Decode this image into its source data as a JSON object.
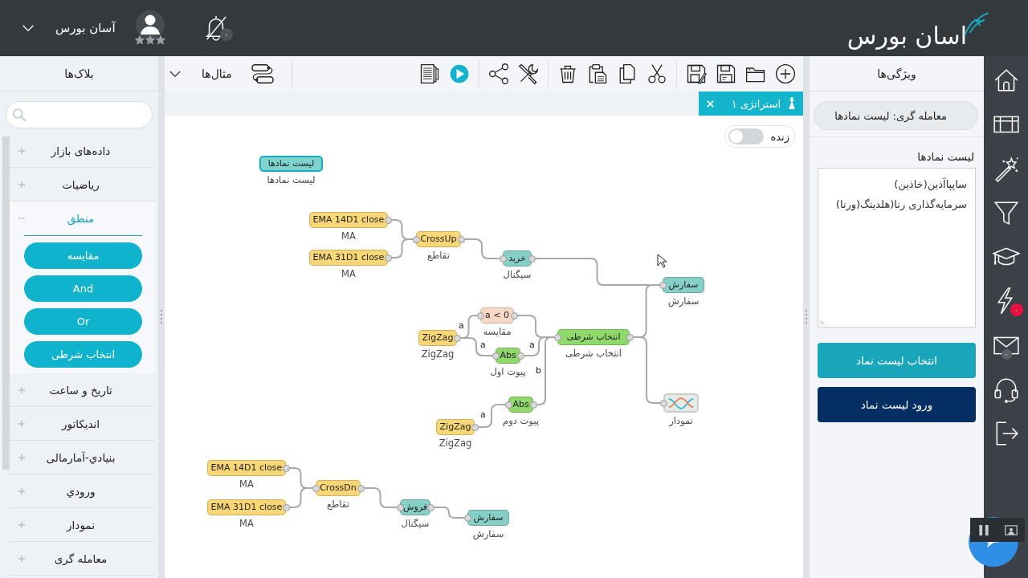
{
  "header": {
    "logo": "اسان بورس",
    "user": {
      "name": "آسان بورس",
      "stars": 3
    },
    "notification_badge": "۰"
  },
  "blocks_panel": {
    "title": "بلاک‌ها",
    "categories": [
      {
        "label": "داده‌های بازار",
        "expanded": false
      },
      {
        "label": "ریاضیات",
        "expanded": false
      },
      {
        "label": "منطق",
        "expanded": true,
        "children": [
          {
            "label": "مقایسه"
          },
          {
            "label": "And"
          },
          {
            "label": "Or"
          },
          {
            "label": "انتخاب شرطی"
          }
        ]
      },
      {
        "label": "تاریخ و ساعت",
        "expanded": false
      },
      {
        "label": "اندیکاتور",
        "expanded": false
      },
      {
        "label": "بنیادي-آمارمالی",
        "expanded": false
      },
      {
        "label": "ورودي",
        "expanded": false
      },
      {
        "label": "نمودار",
        "expanded": false
      },
      {
        "label": "معامله گری",
        "expanded": false
      }
    ]
  },
  "toolbar": {
    "examples_menu": "مثال‌ها"
  },
  "tabs": [
    {
      "label": "استراتژی ۱",
      "selected": true
    }
  ],
  "canvas": {
    "live_toggle": {
      "label": "زنده",
      "on": false
    },
    "nodes": [
      {
        "kind": "block",
        "label": "لیست نمادها",
        "caption": "لیست نمادها",
        "color": "#7fd3cf",
        "selected": true
      },
      {
        "kind": "block",
        "label": "EMA 14D1 close",
        "caption": "MA",
        "color": "#fad776",
        "selected": false
      },
      {
        "kind": "block",
        "label": "EMA 31D1 close",
        "caption": "MA",
        "color": "#fad776",
        "selected": false
      },
      {
        "kind": "block",
        "label": "CrossUp",
        "caption": "تقاطع",
        "color": "#fad776",
        "selected": false
      },
      {
        "kind": "block",
        "label": "خرید",
        "caption": "سیگنال",
        "color": "#86cfc6",
        "selected": false
      },
      {
        "kind": "block",
        "label": "سفارش",
        "caption": "سفارش",
        "color": "#86cfc6",
        "selected": false
      },
      {
        "kind": "block",
        "label": "a < 0",
        "caption": "مقایسه",
        "color": "#f8d9c6",
        "selected": false
      },
      {
        "kind": "block",
        "label": "ZigZag",
        "caption": "ZigZag",
        "color": "#fad776",
        "selected": false
      },
      {
        "kind": "block",
        "label": "Abs",
        "caption": "پیوت اول",
        "color": "#8fd96b",
        "selected": false
      },
      {
        "kind": "block",
        "label": "انتخاب شرطی",
        "caption": "انتخاب شرطی",
        "color": "#8fd96b",
        "selected": false
      },
      {
        "kind": "chart",
        "caption": "نمودار",
        "color": "#e4ebe7",
        "selected": false
      },
      {
        "kind": "block",
        "label": "Abs",
        "caption": "پیوت دوم",
        "color": "#8fd96b",
        "selected": false
      },
      {
        "kind": "block",
        "label": "ZigZag",
        "caption": "ZigZag",
        "color": "#fad776",
        "selected": false
      },
      {
        "kind": "block",
        "label": "EMA 14D1 close",
        "caption": "MA",
        "color": "#fad776",
        "selected": false
      },
      {
        "kind": "block",
        "label": "EMA 31D1 close",
        "caption": "MA",
        "color": "#fad776",
        "selected": false
      },
      {
        "kind": "block",
        "label": "CrossDn",
        "caption": "تقاطع",
        "color": "#fad776",
        "selected": false
      },
      {
        "kind": "block",
        "label": "فروش",
        "caption": "سیگنال",
        "color": "#86cfc6",
        "selected": false
      },
      {
        "kind": "block",
        "label": "سفارش",
        "caption": "سفارش",
        "color": "#86cfc6",
        "selected": false
      }
    ],
    "wire_labels": [
      "a",
      "a",
      "a",
      "b",
      "a"
    ]
  },
  "properties_panel": {
    "title": "ویژگی‌ها",
    "block_name": "معامله گری: لیست نمادها",
    "field_label": "لیست نمادها",
    "symbols": "ساپپاآذین(خاذین)\nسرمایه‌گذاری رنا(هلدینگ(ورنا)",
    "buttons": [
      {
        "label": "انتخاب لیست نماد",
        "kind": "primary"
      },
      {
        "label": "ورود لیست نماد",
        "kind": "dark"
      }
    ]
  },
  "right_nav": {
    "flash_badge": "۰",
    "mail_badge": "۰"
  }
}
